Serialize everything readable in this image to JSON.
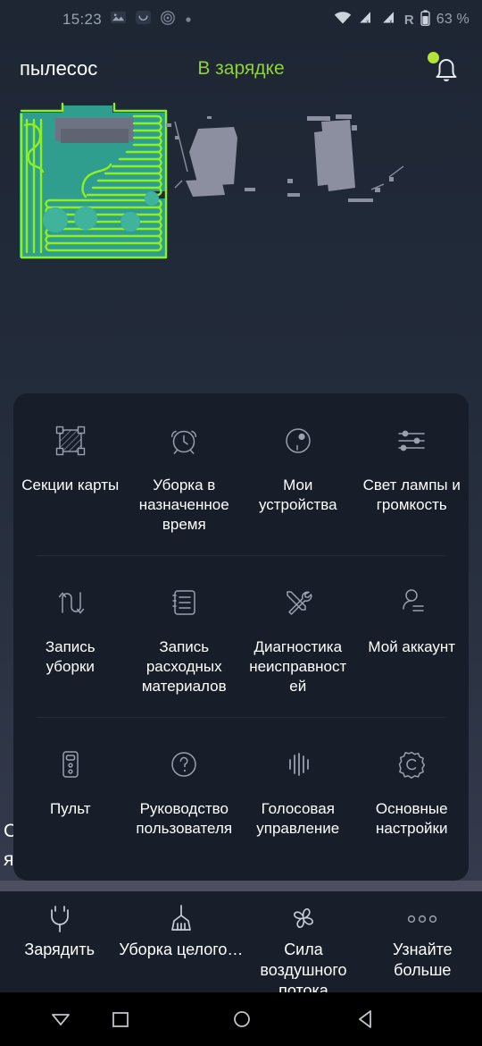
{
  "statusbar": {
    "clock": "15:23",
    "battery_text": "63 %",
    "roaming": "R",
    "icons": [
      "photo-icon",
      "chat-icon",
      "target-icon",
      "dot-icon",
      "wifi-icon",
      "signal-off-icon",
      "signal-off-icon-2",
      "battery-icon"
    ]
  },
  "appbar": {
    "device_name": "пылесос",
    "status": "В зарядке",
    "status_color": "#8fd13a",
    "notification_icon": "bell-icon",
    "notification_dot_color": "#b5e336"
  },
  "map": {
    "cleaned_fill": "#2f9e8f",
    "path_color": "#8ef020",
    "obstacle_color": "#8b8fa0",
    "furniture_color": "#6e7384",
    "background": "#263040"
  },
  "ghost_labels": [
    {
      "text": "С"
    },
    {
      "text": "я"
    }
  ],
  "grid": {
    "rows": [
      [
        {
          "label": "Секции карты",
          "icon": "map-sections-icon"
        },
        {
          "label": "Уборка в назначенное время",
          "icon": "alarm-clock-icon"
        },
        {
          "label": "Мои устройства",
          "icon": "robot-vacuum-icon"
        },
        {
          "label": "Свет лампы и громкость",
          "icon": "sliders-icon"
        }
      ],
      [
        {
          "label": "Запись уборки",
          "icon": "cleaning-path-icon"
        },
        {
          "label": "Запись расходных материалов",
          "icon": "notebook-icon"
        },
        {
          "label": "Диагностика неисправностей",
          "icon": "tools-icon"
        },
        {
          "label": "Мой аккаунт",
          "icon": "account-icon"
        }
      ],
      [
        {
          "label": "Пульт",
          "icon": "remote-control-icon"
        },
        {
          "label": "Руководство пользователя",
          "icon": "question-circle-icon"
        },
        {
          "label": "Голосовая управление",
          "icon": "voice-wave-icon"
        },
        {
          "label": "Основные настройки",
          "icon": "gear-icon"
        }
      ]
    ]
  },
  "bottombar": {
    "items": [
      {
        "label": "Зарядить",
        "icon": "plug-icon"
      },
      {
        "label": "Уборка целого поме...",
        "icon": "brush-icon"
      },
      {
        "label": "Сила воздушного потока",
        "icon": "fan-icon"
      },
      {
        "label": "Узнайте больше",
        "icon": "more-dots-icon"
      }
    ]
  },
  "navbar": {
    "buttons": [
      {
        "name": "hide-keyboard",
        "icon": "triangle-down-icon"
      },
      {
        "name": "recents",
        "icon": "square-icon"
      },
      {
        "name": "home",
        "icon": "circle-icon"
      },
      {
        "name": "back",
        "icon": "triangle-left-icon"
      }
    ]
  }
}
